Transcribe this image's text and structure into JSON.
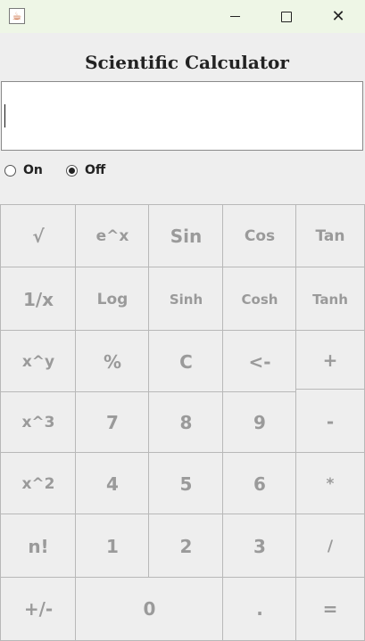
{
  "window": {
    "app_icon": "java-icon",
    "minimize_icon": "minimize-icon",
    "maximize_icon": "maximize-icon",
    "close_symbol": "✕"
  },
  "app_title": "Scientific Calculator",
  "display": {
    "value": ""
  },
  "mode": {
    "on_label": "On",
    "off_label": "Off",
    "selected": "Off"
  },
  "buttons": {
    "sqrt": "√",
    "exp": "e^x",
    "sin": "Sin",
    "cos": "Cos",
    "tan": "Tan",
    "reciprocal": "1/x",
    "log": "Log",
    "sinh": "Sinh",
    "cosh": "Cosh",
    "tanh": "Tanh",
    "power": "x^y",
    "percent": "%",
    "clear": "C",
    "backspace": "<-",
    "plus": "+",
    "cube": "x^3",
    "seven": "7",
    "eight": "8",
    "nine": "9",
    "minus": "-",
    "square": "x^2",
    "four": "4",
    "five": "5",
    "six": "6",
    "multiply": "*",
    "factorial": "n!",
    "one": "1",
    "two": "2",
    "three": "3",
    "divide": "/",
    "negate": "+/-",
    "zero": "0",
    "decimal": ".",
    "equals": "="
  },
  "colors": {
    "title_bar": "#eef6e6",
    "background": "#eeeeee",
    "button_text": "#9a9a9a",
    "button_border": "#b8b8b8"
  }
}
